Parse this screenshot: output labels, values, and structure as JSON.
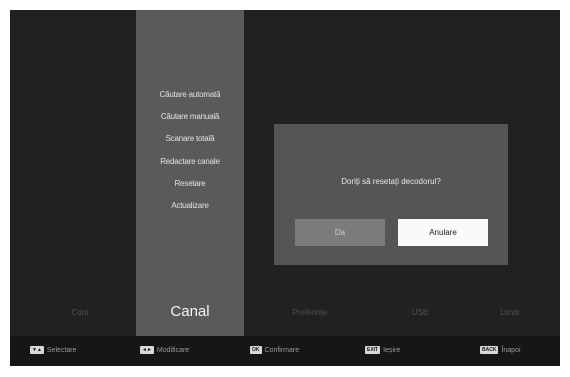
{
  "menu": {
    "items": [
      {
        "label": "Căutare automată"
      },
      {
        "label": "Căutare manuală"
      },
      {
        "label": "Scanare totală"
      },
      {
        "label": "Redactare canale"
      },
      {
        "label": "Resetare"
      },
      {
        "label": "Actualizare"
      }
    ]
  },
  "tabs": [
    {
      "label": "Cont"
    },
    {
      "label": "Canal"
    },
    {
      "label": "Preferințe"
    },
    {
      "label": "USB"
    },
    {
      "label": "Limbi"
    }
  ],
  "dialog": {
    "message": "Doriți să resetați decodorul?",
    "yes_label": "Da",
    "cancel_label": "Anulare"
  },
  "hints": [
    {
      "key": "▼▲",
      "label": "Selectare"
    },
    {
      "key": "◄►",
      "label": "Modificare"
    },
    {
      "key": "OK",
      "label": "Confirmare"
    },
    {
      "key": "EXIT",
      "label": "Ieșire"
    },
    {
      "key": "BACK",
      "label": "Înapoi"
    }
  ],
  "colors": {
    "background": "#212121",
    "menu_column": "#5a5a5a",
    "dialog": "#555555",
    "button_focused": "#fafafa"
  }
}
